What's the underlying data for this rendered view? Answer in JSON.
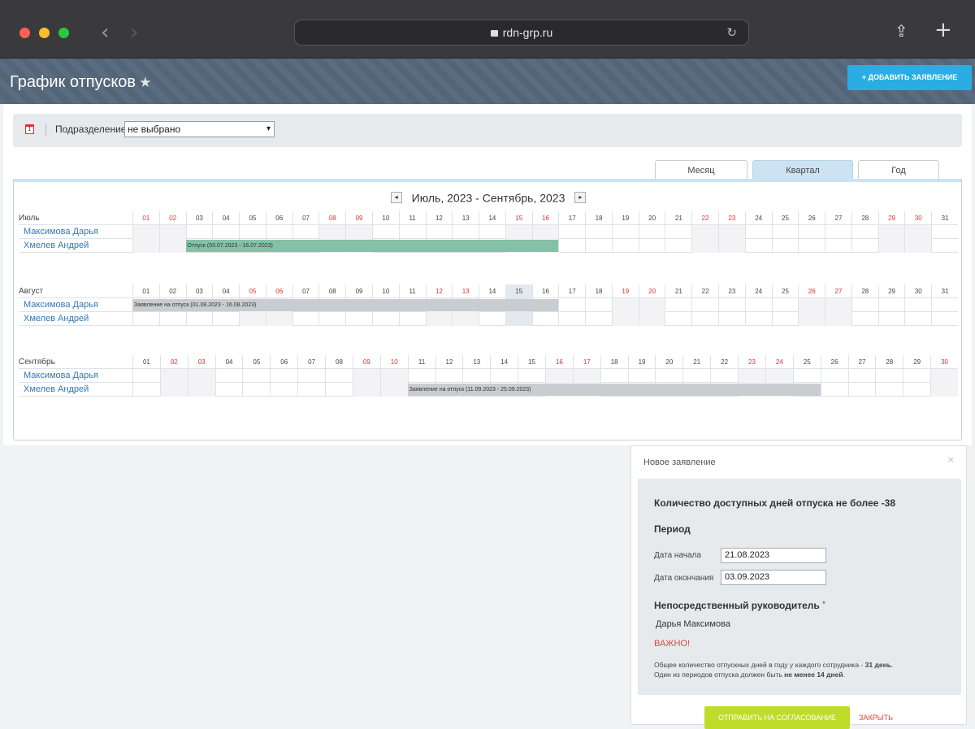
{
  "browser": {
    "url": "rdn-grp.ru",
    "back_icon": "chevron-left",
    "forward_icon": "chevron-right",
    "reload_icon": "reload",
    "share_icon": "share",
    "new_tab_icon": "plus"
  },
  "page": {
    "title": "График отпусков",
    "add_button": "+ ДОБАВИТЬ ЗАЯВЛЕНИЕ"
  },
  "filter": {
    "label": "Подразделение:",
    "selected": "не выбрано",
    "calendar_icon_text": "1"
  },
  "tabs": [
    {
      "label": "Месяц",
      "active": false
    },
    {
      "label": "Квартал",
      "active": true
    },
    {
      "label": "Год",
      "active": false
    }
  ],
  "calendar": {
    "period": "Июль, 2023 - Сентябрь, 2023",
    "prev_label": "◂",
    "next_label": "▸",
    "months": [
      {
        "name": "Июль",
        "days": 31,
        "weekends": [
          1,
          2,
          8,
          9,
          15,
          16,
          22,
          23,
          29,
          30
        ],
        "people": [
          {
            "name": "Максимова Дарья"
          },
          {
            "name": "Хмелев Андрей",
            "bar": {
              "label": "Отпуск (03.07.2023 - 16.07.2023)",
              "start": 3,
              "end": 16,
              "kind": "green"
            }
          }
        ]
      },
      {
        "name": "Август",
        "days": 31,
        "weekends": [
          5,
          6,
          12,
          13,
          19,
          20,
          26,
          27
        ],
        "highlight_day": 15,
        "people": [
          {
            "name": "Максимова Дарья",
            "bar": {
              "label": "Заявление на отпуск (01.08.2023 - 16.08.2023)",
              "start": 1,
              "end": 16,
              "kind": "grey"
            }
          },
          {
            "name": "Хмелев Андрей"
          }
        ]
      },
      {
        "name": "Сентябрь",
        "days": 30,
        "weekends": [
          2,
          3,
          9,
          10,
          16,
          17,
          23,
          24,
          30
        ],
        "people": [
          {
            "name": "Максимова Дарья"
          },
          {
            "name": "Хмелев Андрей",
            "bar": {
              "label": "Заявление на отпуск (11.09.2023 - 25.09.2023)",
              "start": 11,
              "end": 25,
              "kind": "grey"
            }
          }
        ]
      }
    ]
  },
  "modal": {
    "title": "Новое заявление",
    "close": "×",
    "available_days": "Количество доступных дней отпуска не более -38",
    "period_label": "Период",
    "start_label": "Дата начала",
    "start_value": "21.08.2023",
    "end_label": "Дата окончания",
    "end_value": "03.09.2023",
    "manager_label": "Непосредственный руководитель",
    "required_mark": "*",
    "manager_value": "Дарья Максимова",
    "important": "ВАЖНО!",
    "note_line1_pre": "Общее количество отпускных дней в году у каждого сотрудника - ",
    "note_line1_bold": "31 день",
    "note_line1_post": ".",
    "note_line2_pre": "Один из периодов отпуска должен быть ",
    "note_line2_bold": "не менее 14 дней",
    "note_line2_post": ".",
    "send_button": "ОТПРАВИТЬ НА СОГЛАСОВАНИЕ",
    "close_button": "ЗАКРЫТЬ"
  },
  "colors": {
    "header_bg": "#55677a",
    "accent_blue": "#29aee3",
    "weekend_red": "#d33",
    "vacation_green": "#84c1a7",
    "request_grey": "#c9ccd0",
    "send_green": "#bfdc2a",
    "danger_red": "#e0483b"
  }
}
